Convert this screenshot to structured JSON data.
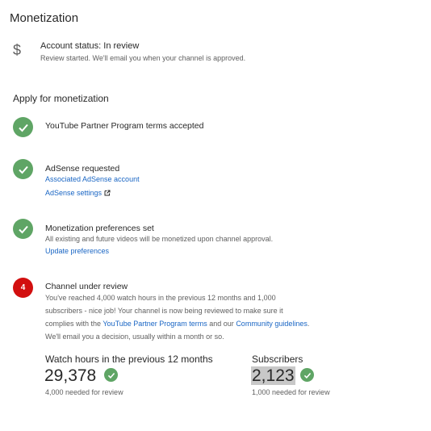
{
  "page": {
    "title": "Monetization"
  },
  "account": {
    "status_title": "Account status: In review",
    "status_sub": "Review started. We'll email you when your channel is approved.",
    "icon": "dollar-icon"
  },
  "apply": {
    "section_title": "Apply for monetization",
    "steps": [
      {
        "title": "YouTube Partner Program terms accepted",
        "icon": "check-icon"
      },
      {
        "title": "AdSense requested",
        "link1": "Associated AdSense account",
        "link2": "AdSense settings",
        "icon": "check-icon"
      },
      {
        "title": "Monetization preferences set",
        "text": "All existing and future videos will be monetized upon channel approval.",
        "link": "Update preferences",
        "icon": "check-icon"
      },
      {
        "number": "4",
        "title": "Channel under review",
        "line1": "You've reached 4,000 watch hours in the previous 12 months and 1,000",
        "line2": "subscribers - nice job! Your channel is now being reviewed to make sure it",
        "line3_pre": "complies with the ",
        "line3_link1": "YouTube Partner Program terms",
        "line3_mid": " and our ",
        "line3_link2": "Community guidelines",
        "line3_post": ".",
        "line4": "We'll email you a decision, usually within a month or so."
      }
    ]
  },
  "stats": {
    "watch": {
      "label": "Watch hours in the previous 12 months",
      "value": "29,378",
      "note": "4,000 needed for review"
    },
    "subs": {
      "label": "Subscribers",
      "value": "2,123",
      "note": "1,000 needed for review"
    }
  },
  "colors": {
    "green": "#5fa565",
    "red": "#d20f0f",
    "link": "#1a66c4"
  }
}
